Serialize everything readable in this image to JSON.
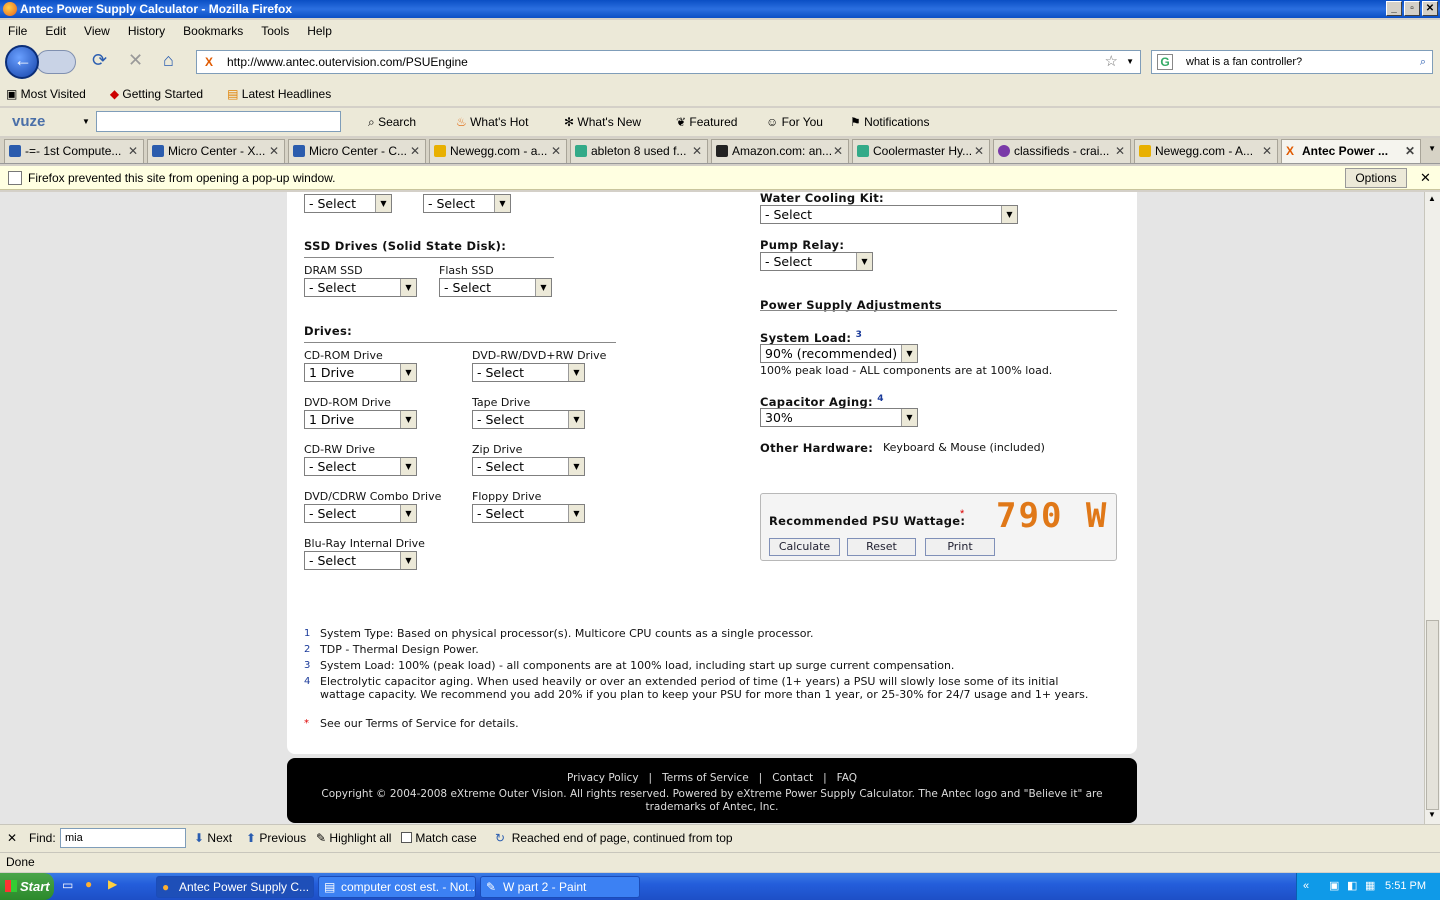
{
  "window": {
    "title": "Antec Power Supply Calculator - Mozilla Firefox"
  },
  "menu": [
    "File",
    "Edit",
    "View",
    "History",
    "Bookmarks",
    "Tools",
    "Help"
  ],
  "nav": {
    "url": "http://www.antec.outervision.com/PSUEngine",
    "search_value": "what is a fan controller?"
  },
  "bookmarks": [
    "Most Visited",
    "Getting Started",
    "Latest Headlines"
  ],
  "toolbar2": {
    "brand": "vuze",
    "items": [
      "Search",
      "What's Hot",
      "What's New",
      "Featured",
      "For You",
      "Notifications"
    ]
  },
  "tabs": [
    "-=- 1st Compute...",
    "Micro Center - X...",
    "Micro Center - C...",
    "Newegg.com - a...",
    "ableton 8 used f...",
    "Amazon.com: an...",
    "Coolermaster Hy...",
    "classifieds - crai...",
    "Newegg.com - A...",
    "Antec Power ..."
  ],
  "notification": {
    "text": "Firefox prevented this site from opening a pop-up window.",
    "options": "Options"
  },
  "form": {
    "top_selects": [
      "- Select",
      "- Select"
    ],
    "ssd": {
      "heading": "SSD Drives (Solid State Disk):",
      "dram_label": "DRAM SSD",
      "dram_value": "- Select",
      "flash_label": "Flash SSD",
      "flash_value": "- Select"
    },
    "drives": {
      "heading": "Drives:",
      "cdrom": {
        "label": "CD-ROM Drive",
        "value": "1 Drive"
      },
      "dvdrw": {
        "label": "DVD-RW/DVD+RW Drive",
        "value": "- Select"
      },
      "dvdrom": {
        "label": "DVD-ROM Drive",
        "value": "1 Drive"
      },
      "tape": {
        "label": "Tape Drive",
        "value": "- Select"
      },
      "cdrw": {
        "label": "CD-RW Drive",
        "value": "- Select"
      },
      "zip": {
        "label": "Zip Drive",
        "value": "- Select"
      },
      "combo": {
        "label": "DVD/CDRW Combo Drive",
        "value": "- Select"
      },
      "floppy": {
        "label": "Floppy Drive",
        "value": "- Select"
      },
      "bluray": {
        "label": "Blu-Ray Internal Drive",
        "value": "- Select"
      }
    },
    "water": {
      "label": "Water Cooling Kit:",
      "value": "- Select"
    },
    "pump": {
      "label": "Pump Relay:",
      "value": "- Select"
    },
    "psu_adj": {
      "heading": "Power Supply Adjustments",
      "load_label": "System Load:",
      "load_sup": "3",
      "load_value": "90% (recommended)",
      "load_note": "100% peak load - ALL components are at 100% load.",
      "aging_label": "Capacitor Aging:",
      "aging_sup": "4",
      "aging_value": "30%",
      "other_label": "Other Hardware:",
      "other_value": "Keyboard & Mouse (included)"
    },
    "result": {
      "label": "Recommended PSU Wattage:",
      "star": "*",
      "wattage": "790 W",
      "calculate": "Calculate",
      "reset": "Reset",
      "print": "Print"
    }
  },
  "notes": [
    {
      "n": "1",
      "text": "System Type: Based on physical processor(s). Multicore CPU counts as a single processor."
    },
    {
      "n": "2",
      "text": "TDP - Thermal Design Power."
    },
    {
      "n": "3",
      "text": "System Load: 100% (peak load) - all components are at 100% load, including start up surge current compensation."
    },
    {
      "n": "4",
      "text": "Electrolytic capacitor aging. When used heavily or over an extended period of time (1+ years) a PSU will slowly lose some of its initial wattage capacity. We recommend you add 20% if you plan to keep your PSU for more than 1 year, or 25-30% for 24/7 usage and 1+ years."
    },
    {
      "n": "*",
      "text": "See our Terms of Service for details."
    }
  ],
  "footer": {
    "links": [
      "Privacy Policy",
      "Terms of Service",
      "Contact",
      "FAQ"
    ],
    "copyright": "Copyright © 2004-2008 eXtreme Outer Vision. All rights reserved. Powered by eXtreme Power Supply Calculator. The Antec logo and \"Believe it\" are trademarks of Antec, Inc."
  },
  "findbar": {
    "label": "Find:",
    "value": "mia",
    "next": "Next",
    "previous": "Previous",
    "highlight": "Highlight all",
    "match_case": "Match case",
    "message": "Reached end of page, continued from top"
  },
  "status": "Done",
  "taskbar": {
    "start": "Start",
    "tasks": [
      "Antec Power Supply C...",
      "computer cost est. - Not...",
      "W part 2 - Paint"
    ],
    "time": "5:51 PM"
  }
}
